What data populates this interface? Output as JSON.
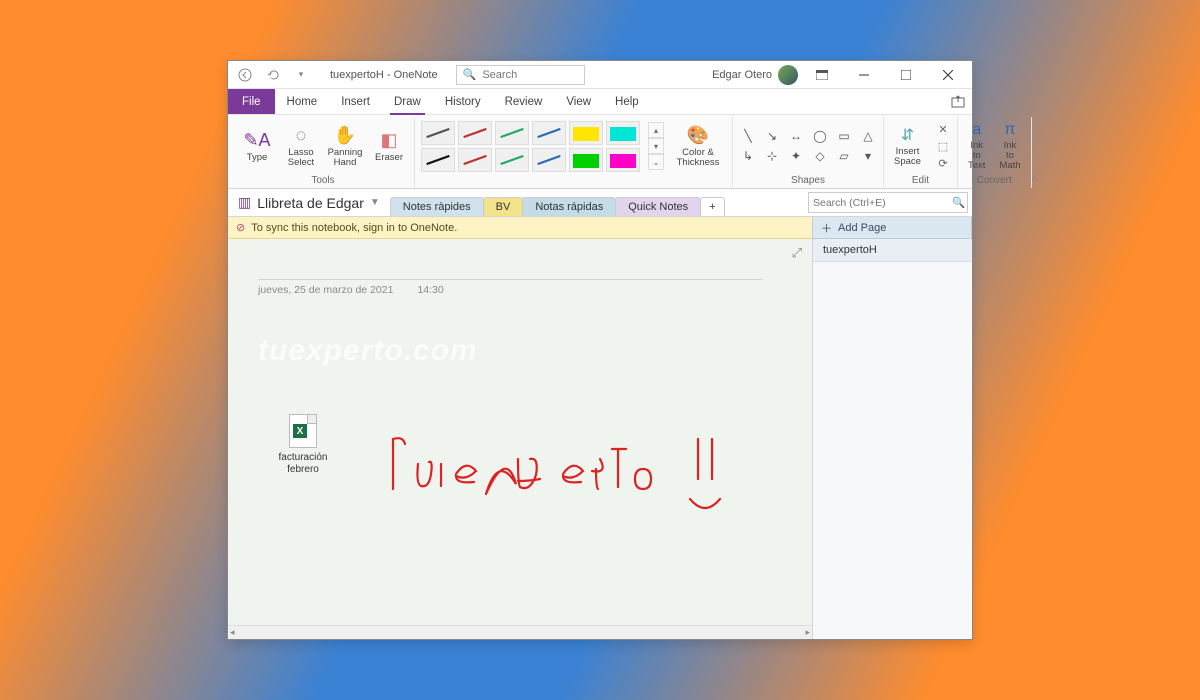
{
  "title": "tuexpertoH  -  OneNote",
  "search_placeholder": "Search",
  "user_name": "Edgar Otero",
  "ribbon": {
    "tabs": [
      "File",
      "Home",
      "Insert",
      "Draw",
      "History",
      "Review",
      "View",
      "Help"
    ],
    "active_tab": "Draw",
    "tools": {
      "type": "Type",
      "lasso": "Lasso Select",
      "panning": "Panning Hand",
      "eraser": "Eraser",
      "group_label": "Tools"
    },
    "color_thickness": "Color & Thickness",
    "shapes_label": "Shapes",
    "edit": {
      "insert_space": "Insert Space",
      "group_label": "Edit"
    },
    "convert": {
      "ink_to_text": "Ink to Text",
      "ink_to_math": "Ink to Math",
      "group_label": "Convert"
    },
    "pen_colors_row1": [
      "#555555",
      "#b33",
      "#2a6",
      "#2a6fb3",
      "#d4b300",
      "#ffe600",
      "#00e6d6"
    ],
    "pen_colors_row2": [
      "#111111",
      "#b33",
      "#2a6",
      "#2a6fb3",
      "#00d000",
      "#ff00c8"
    ]
  },
  "notebook": {
    "name": "Llibreta de Edgar",
    "sections": [
      {
        "label": "Notes ràpides",
        "style": "blue"
      },
      {
        "label": "BV",
        "style": "yellow"
      },
      {
        "label": "Notas rápidas",
        "style": "active"
      },
      {
        "label": "Quick Notes",
        "style": "purple"
      }
    ],
    "add_section": "+",
    "pages_search_placeholder": "Search (Ctrl+E)"
  },
  "info_bar": "To sync this notebook, sign in to OneNote.",
  "pages_panel": {
    "add_page": "Add Page",
    "items": [
      "tuexpertoH"
    ]
  },
  "page": {
    "date": "jueves, 25 de marzo de 2021",
    "time": "14:30",
    "watermark": "tuexperto.com",
    "attachment_name": "facturación febrero",
    "ink_text": "tuexperto"
  }
}
